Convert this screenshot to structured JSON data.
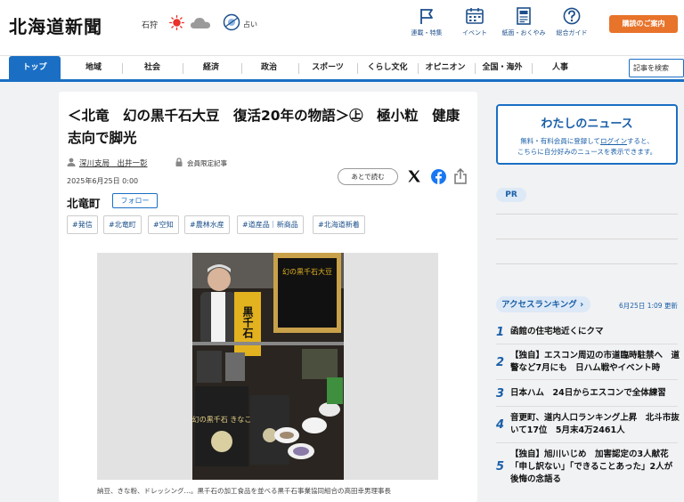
{
  "header": {
    "logo": "北海道新聞",
    "weather_location": "石狩",
    "weather_icons": [
      "sun-icon",
      "cloud-icon"
    ],
    "fortune": "占い",
    "nav": [
      {
        "label": "連載・特集",
        "icon": "flag-icon"
      },
      {
        "label": "イベント",
        "icon": "calendar-icon"
      },
      {
        "label": "紙面・おくやみ",
        "icon": "newspaper-icon"
      },
      {
        "label": "総合ガイド",
        "icon": "help-icon"
      }
    ],
    "subscribe": "購読のご案内"
  },
  "nav": {
    "items": [
      "トップ",
      "地域",
      "社会",
      "経済",
      "政治",
      "スポーツ",
      "くらし文化",
      "オピニオン",
      "全国・海外",
      "人事"
    ],
    "active": "トップ",
    "search_placeholder": "記事を検索"
  },
  "article": {
    "title": "＜北竜　幻の黒千石大豆　復活20年の物語＞㊤　極小粒　健康志向で脚光",
    "author": "深川支局　出井一彰",
    "member_label": "会員限定記事",
    "date": "2025年6月25日 0:00",
    "read_later": "あとで読む",
    "area": "北竜町",
    "follow": "フォロー",
    "tags": [
      "#発信",
      "#北竜町",
      "#空知",
      "#農林水産",
      "#道産品｜新商品",
      "#北海道新着"
    ],
    "photo_text": {
      "product_label": "黒千石",
      "box_label": "幻の黒千石大豆",
      "bag_label": "幻の黒千石 きなこ"
    },
    "caption": "納豆、きな粉、ドレッシング…。黒千石の加工食品を並べる黒千石事業協同組合の高田幸男理事長"
  },
  "sidebar": {
    "mynews": {
      "title": "わたしのニュース",
      "line1_pre": "無料・有料会員に登録して",
      "line1_link": "ログイン",
      "line1_post": "すると、",
      "line2": "こちらに自分好みのニュースを表示できます。"
    },
    "pr": "PR",
    "ranking": {
      "title": "アクセスランキング ",
      "date": "6月25日 1:09 更新",
      "items": [
        {
          "rank": "1",
          "title": "函館の住宅地近くにクマ"
        },
        {
          "rank": "2",
          "title": "【独自】エスコン周辺の市道臨時駐禁へ　道警など7月にも　日ハム戦やイベント時"
        },
        {
          "rank": "3",
          "title": "日本ハム　24日からエスコンで全体練習"
        },
        {
          "rank": "4",
          "title": "音更町、道内人口ランキング上昇　北斗市抜いて17位　5月末4万2461人"
        },
        {
          "rank": "5",
          "title": "【独自】旭川いじめ　加害認定の3人献花「申し訳ない」「できることあった」2人が後悔の念語る"
        }
      ]
    }
  }
}
